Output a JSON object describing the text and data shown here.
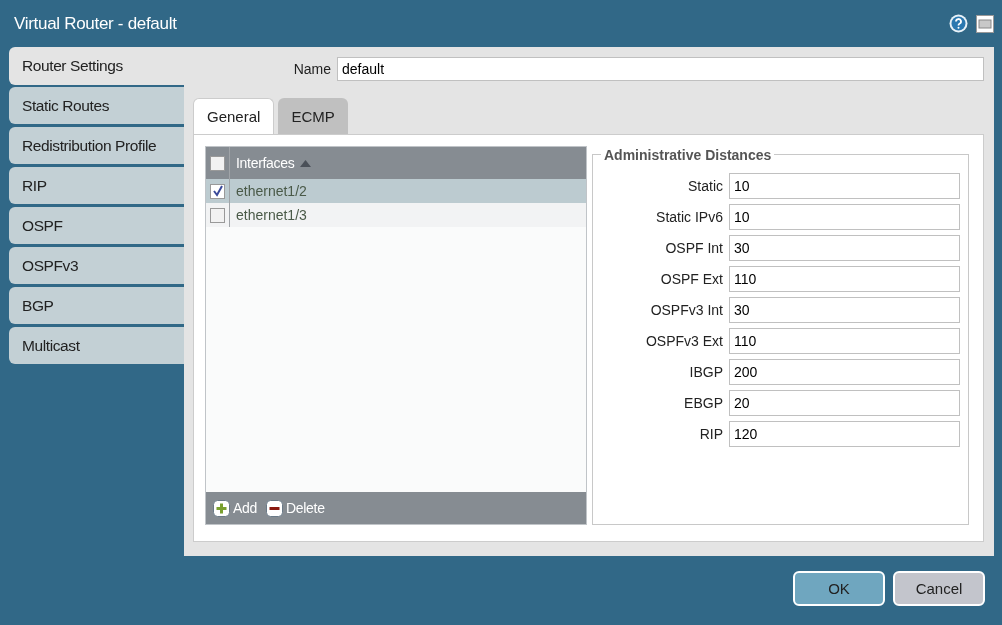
{
  "window": {
    "title": "Virtual Router - default"
  },
  "sidebar": {
    "items": [
      {
        "label": "Router Settings",
        "selected": true
      },
      {
        "label": "Static Routes",
        "selected": false
      },
      {
        "label": "Redistribution Profile",
        "selected": false
      },
      {
        "label": "RIP",
        "selected": false
      },
      {
        "label": "OSPF",
        "selected": false
      },
      {
        "label": "OSPFv3",
        "selected": false
      },
      {
        "label": "BGP",
        "selected": false
      },
      {
        "label": "Multicast",
        "selected": false
      }
    ]
  },
  "name_field": {
    "label": "Name",
    "value": "default"
  },
  "tabs": [
    {
      "label": "General",
      "selected": true
    },
    {
      "label": "ECMP",
      "selected": false
    }
  ],
  "interfaces": {
    "header": "Interfaces",
    "header_checked": false,
    "rows": [
      {
        "name": "ethernet1/2",
        "checked": true,
        "selected": true
      },
      {
        "name": "ethernet1/3",
        "checked": false,
        "selected": false
      }
    ],
    "actions": [
      {
        "kind": "add",
        "label": "Add"
      },
      {
        "kind": "delete",
        "label": "Delete"
      }
    ]
  },
  "admin_distances": {
    "title": "Administrative Distances",
    "fields": [
      {
        "label": "Static",
        "value": "10"
      },
      {
        "label": "Static IPv6",
        "value": "10"
      },
      {
        "label": "OSPF Int",
        "value": "30"
      },
      {
        "label": "OSPF Ext",
        "value": "110"
      },
      {
        "label": "OSPFv3 Int",
        "value": "30"
      },
      {
        "label": "OSPFv3 Ext",
        "value": "110"
      },
      {
        "label": "IBGP",
        "value": "200"
      },
      {
        "label": "EBGP",
        "value": "20"
      },
      {
        "label": "RIP",
        "value": "120"
      }
    ]
  },
  "buttons": [
    {
      "kind": "primary",
      "label": "OK"
    },
    {
      "kind": "secondary",
      "label": "Cancel"
    }
  ]
}
